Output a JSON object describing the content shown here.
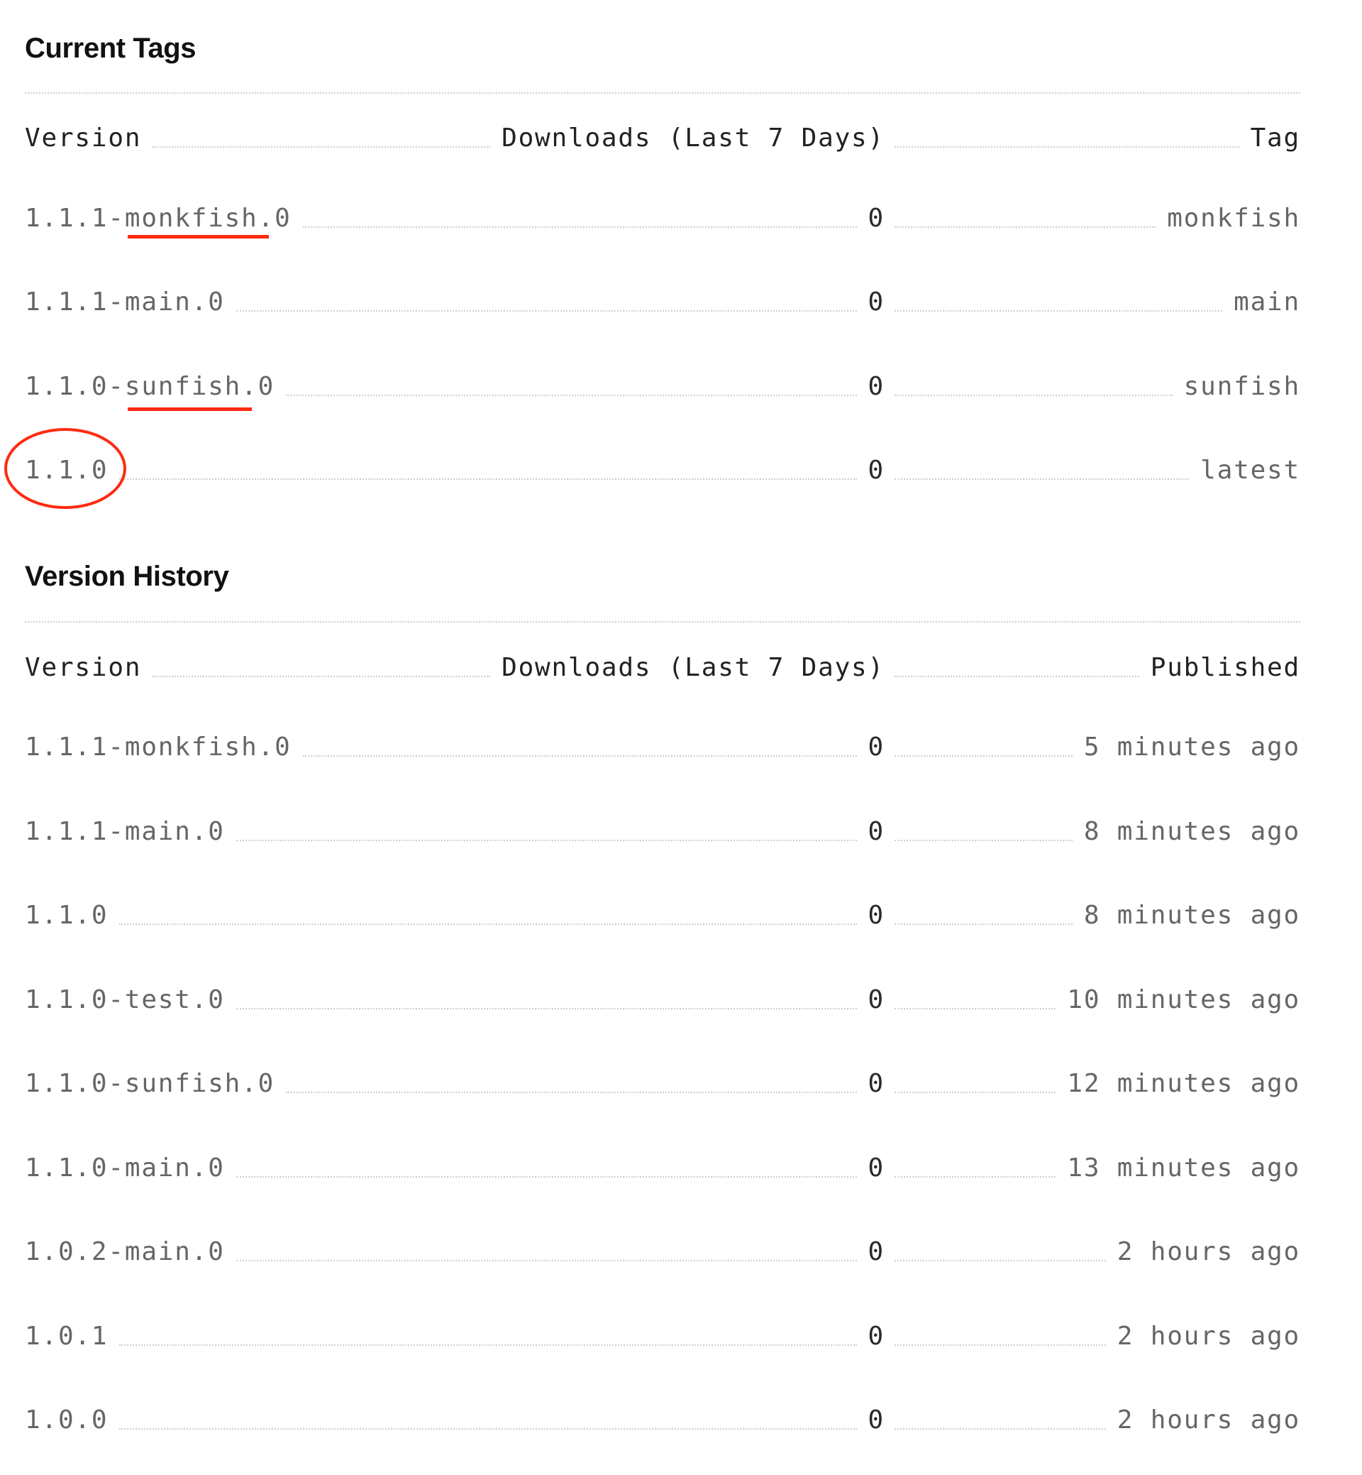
{
  "current_tags": {
    "title": "Current Tags",
    "columns": {
      "version": "Version",
      "downloads": "Downloads (Last 7 Days)",
      "tag": "Tag"
    },
    "rows": [
      {
        "version": "1.1.1-monkfish.0",
        "downloads": "0",
        "tag": "monkfish"
      },
      {
        "version": "1.1.1-main.0",
        "downloads": "0",
        "tag": "main"
      },
      {
        "version": "1.1.0-sunfish.0",
        "downloads": "0",
        "tag": "sunfish"
      },
      {
        "version": "1.1.0",
        "downloads": "0",
        "tag": "latest"
      }
    ]
  },
  "version_history": {
    "title": "Version History",
    "columns": {
      "version": "Version",
      "downloads": "Downloads (Last 7 Days)",
      "published": "Published"
    },
    "rows": [
      {
        "version": "1.1.1-monkfish.0",
        "downloads": "0",
        "published": "5 minutes ago"
      },
      {
        "version": "1.1.1-main.0",
        "downloads": "0",
        "published": "8 minutes ago"
      },
      {
        "version": "1.1.0",
        "downloads": "0",
        "published": "8 minutes ago"
      },
      {
        "version": "1.1.0-test.0",
        "downloads": "0",
        "published": "10 minutes ago"
      },
      {
        "version": "1.1.0-sunfish.0",
        "downloads": "0",
        "published": "12 minutes ago"
      },
      {
        "version": "1.1.0-main.0",
        "downloads": "0",
        "published": "13 minutes ago"
      },
      {
        "version": "1.0.2-main.0",
        "downloads": "0",
        "published": "2 hours ago"
      },
      {
        "version": "1.0.1",
        "downloads": "0",
        "published": "2 hours ago"
      },
      {
        "version": "1.0.0",
        "downloads": "0",
        "published": "2 hours ago"
      }
    ]
  },
  "annotations": {
    "color": "#ff2a10",
    "items": [
      {
        "type": "underline",
        "target": "current_tags.rows.0.version",
        "text": "monkfish"
      },
      {
        "type": "underline",
        "target": "current_tags.rows.2.version",
        "text": "sunfish"
      },
      {
        "type": "circle",
        "target": "current_tags.rows.3.version",
        "text": "1.1.0"
      }
    ]
  }
}
